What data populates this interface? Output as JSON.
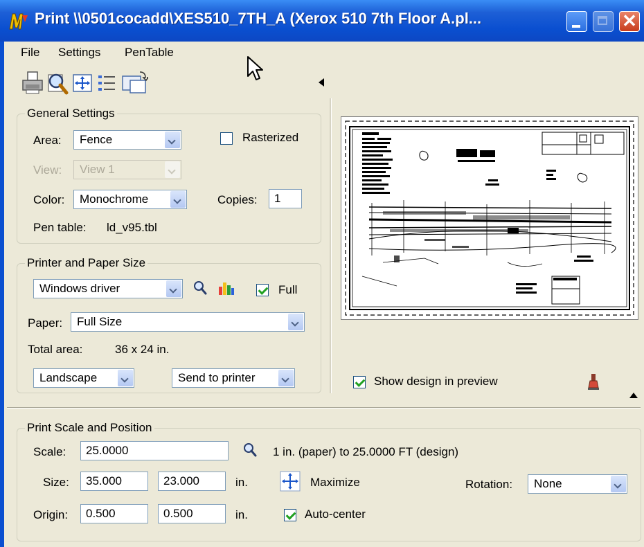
{
  "window": {
    "title": "Print  \\\\0501cocadd\\XES510_7TH_A  (Xerox 510 7th Floor A.pl...",
    "close_glyph": "✕"
  },
  "menu": {
    "file": "File",
    "settings": "Settings",
    "pentable": "PenTable"
  },
  "toolbar": {
    "icons": [
      "printer-icon",
      "preview-magnifier-icon",
      "maximize-crosshair-icon",
      "list-properties-icon",
      "paper-layout-icon"
    ]
  },
  "general_settings": {
    "title": "General Settings",
    "area_label": "Area:",
    "area_value": "Fence",
    "rasterized_label": "Rasterized",
    "rasterized_checked": false,
    "view_label": "View:",
    "view_value": "View 1",
    "color_label": "Color:",
    "color_value": "Monochrome",
    "copies_label": "Copies:",
    "copies_value": "1",
    "pen_table_label": "Pen table:",
    "pen_table_value": "ld_v95.tbl"
  },
  "printer_paper": {
    "title": "Printer and Paper Size",
    "driver_value": "Windows driver",
    "full_label": "Full",
    "full_checked": true,
    "paper_label": "Paper:",
    "paper_value": "Full Size",
    "total_area_label": "Total area:",
    "total_area_value": "36 x 24 in.",
    "orientation_value": "Landscape",
    "output_value": "Send to printer"
  },
  "preview": {
    "show_design_label": "Show design in preview",
    "show_design_checked": true
  },
  "scale_position": {
    "title": "Print Scale and Position",
    "scale_label": "Scale:",
    "scale_value": "25.0000",
    "scale_description": "1 in. (paper) to 25.0000 FT (design)",
    "size_label": "Size:",
    "size_x": "35.000",
    "size_y": "23.000",
    "size_units": "in.",
    "maximize_label": "Maximize",
    "rotation_label": "Rotation:",
    "rotation_value": "None",
    "origin_label": "Origin:",
    "origin_x": "0.500",
    "origin_y": "0.500",
    "origin_units": "in.",
    "autocenter_label": "Auto-center",
    "autocenter_checked": true
  },
  "colors": {
    "titlebar": "#0a4fd0",
    "dialog_bg": "#ece9d8",
    "check_mark": "#21a121"
  }
}
